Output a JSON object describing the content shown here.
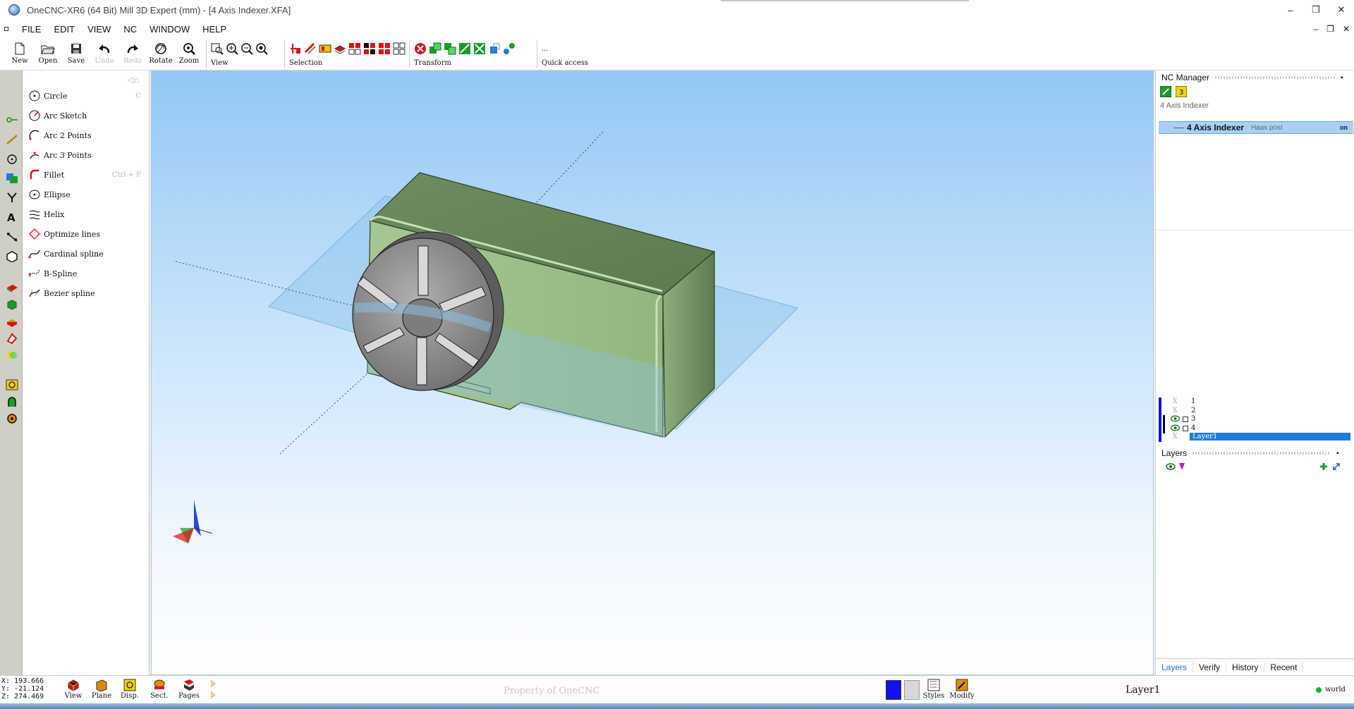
{
  "window": {
    "title": "OneCNC-XR6 (64 Bit) Mill 3D Expert (mm) - [4 Axis Indexer.XFA]",
    "controls": [
      "–",
      "❐",
      "✕"
    ],
    "mdi_controls": [
      "–",
      "❐",
      "✕"
    ]
  },
  "menu": [
    "FILE",
    "EDIT",
    "VIEW",
    "NC",
    "WINDOW",
    "HELP"
  ],
  "toolbar": {
    "new": "New",
    "open": "Open",
    "save": "Save",
    "undo": "Undo",
    "redo": "Redo",
    "rotate": "Rotate",
    "zoom": "Zoom",
    "view": "View",
    "selection": "Selection",
    "transform": "Transform",
    "quick_access": "Quick access",
    "quick_dots": "..."
  },
  "sketch_panel": {
    "items": [
      {
        "label": "Circle",
        "shortcut": "C"
      },
      {
        "label": "Arc Sketch",
        "shortcut": ""
      },
      {
        "label": "Arc 2 Points",
        "shortcut": ""
      },
      {
        "label": "Arc 3 Points",
        "shortcut": ""
      },
      {
        "label": "Fillet",
        "shortcut": "Ctrl + F"
      },
      {
        "label": "Ellipse",
        "shortcut": ""
      },
      {
        "label": "Helix",
        "shortcut": ""
      },
      {
        "label": "Optimize lines",
        "shortcut": ""
      },
      {
        "label": "Cardinal spline",
        "shortcut": ""
      },
      {
        "label": "B-Spline",
        "shortcut": ""
      },
      {
        "label": "Bezier spline",
        "shortcut": ""
      }
    ]
  },
  "nc_manager": {
    "title": "NC Manager",
    "group": "4 Axis Indexer",
    "setup_name": "4 Axis Indexer",
    "post": "Haas post",
    "state": "on"
  },
  "layers": {
    "title": "Layers",
    "rows": [
      {
        "name": "1",
        "visible": false
      },
      {
        "name": "2",
        "visible": false
      },
      {
        "name": "3",
        "visible": true
      },
      {
        "name": "4",
        "visible": true
      },
      {
        "name": "Layer1",
        "visible": false,
        "selected": true
      }
    ],
    "hidden_mark": "X"
  },
  "tabs": [
    "Layers",
    "Verify",
    "History",
    "Recent"
  ],
  "status": {
    "x": "X: 193.666",
    "y": "Y: -21.124",
    "z": "Z: 274.469",
    "buttons": [
      "View",
      "Plane",
      "Disp.",
      "Sect.",
      "Pages"
    ],
    "watermark": "Property of OneCNC",
    "styles": "Styles",
    "modify": "Modify",
    "current_layer": "Layer1",
    "coord_system": "world"
  },
  "colors": {
    "accent": "#1e7be0",
    "model_green": "#9fbf8a",
    "chuck_gray": "#8a8a8a",
    "plane_blue": "#8cc3ea"
  }
}
